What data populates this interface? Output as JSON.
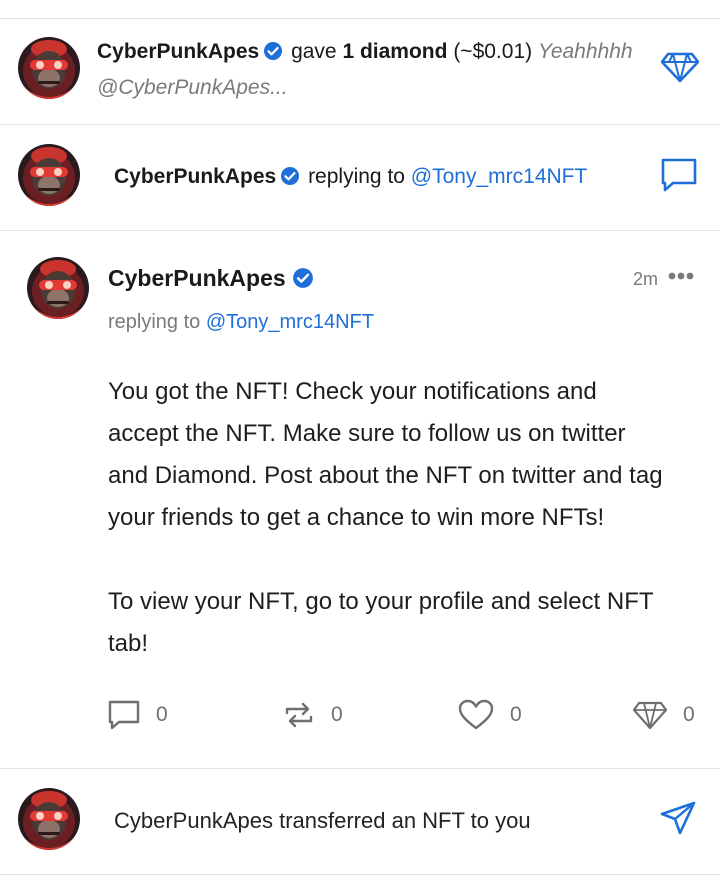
{
  "colors": {
    "accent": "#1e6fd9",
    "muted": "#7a7a7a",
    "divider": "#e2e2e2",
    "text": "#1a1a1a"
  },
  "notif_diamond": {
    "user": "CyberPunkApes",
    "action": "gave",
    "amount": "1 diamond",
    "value": "(~$0.01)",
    "message": "Yeahhhhh",
    "handle": "@CyberPunkApes...",
    "icon": "diamond-icon"
  },
  "notif_reply": {
    "user": "CyberPunkApes",
    "action": "replying to",
    "target": "@Tony_mrc14NFT",
    "icon": "comment-icon"
  },
  "post": {
    "user": "CyberPunkApes",
    "time": "2m",
    "more_icon": "ellipsis-icon",
    "reply_prefix": "replying to",
    "reply_target": "@Tony_mrc14NFT",
    "body_lines": [
      "You got the NFT! Check your notifications and",
      "accept the NFT. Make sure to follow us on twitter",
      "and Diamond. Post about the NFT on twitter and tag",
      "your friends to get a chance to win more NFTs!",
      "",
      "To view your NFT, go to your profile and select NFT",
      "tab!"
    ],
    "actions": {
      "comments": "0",
      "reposts": "0",
      "likes": "0",
      "diamonds": "0"
    }
  },
  "notif_transfer": {
    "text": "CyberPunkApes transferred an NFT to you",
    "icon": "send-icon"
  }
}
